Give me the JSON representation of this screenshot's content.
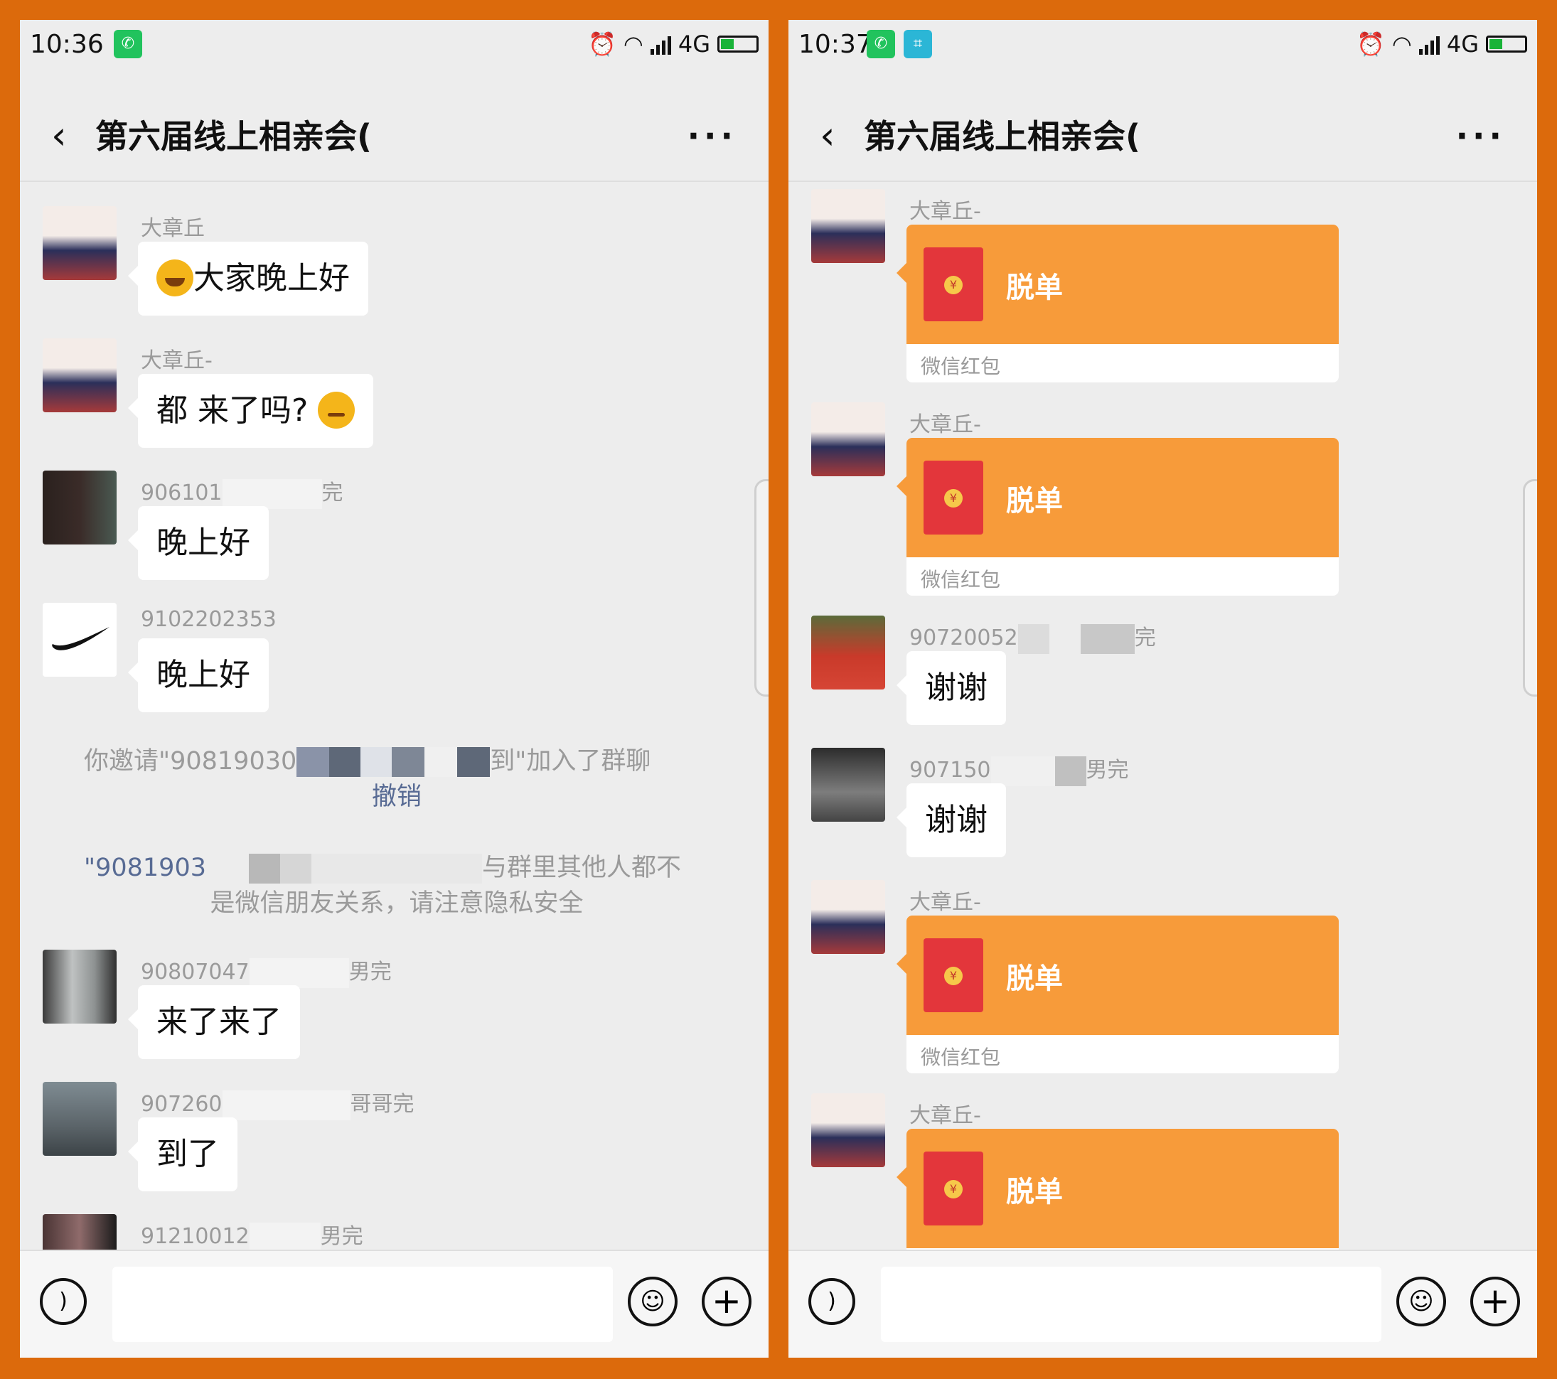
{
  "left": {
    "status": {
      "time": "10:36",
      "network": "4G"
    },
    "title": "第六届线上相亲会(",
    "messages": [
      {
        "sender": "大章丘",
        "text": "大家晚上好"
      },
      {
        "sender": "大章丘-",
        "text": "都 来了吗?"
      },
      {
        "sender": "906101",
        "sender_tail": "完",
        "text": "晚上好"
      },
      {
        "sender": "9102202353",
        "text": "晚上好"
      },
      {
        "sender": "90807047",
        "sender_tail": "男完",
        "text": "来了来了"
      },
      {
        "sender": "907260",
        "sender_tail": "哥哥完",
        "text": "到了"
      },
      {
        "sender": "91210012",
        "sender_tail": "男完",
        "text": ""
      }
    ],
    "system1": {
      "prefix": "你邀请\"90819030",
      "suffix": "到\"加入了群聊",
      "link": "撤销"
    },
    "system2": {
      "prefix": "\"9081903",
      "suffix": "与群里其他人都不",
      "line2": "是微信朋友关系，请注意隐私安全"
    }
  },
  "right": {
    "status": {
      "time": "10:37",
      "network": "4G"
    },
    "title": "第六届线上相亲会(",
    "packet_sender": "大章丘-",
    "packet_title": "脱单",
    "packet_footer": "微信红包",
    "thanks": [
      {
        "sender": "90720052",
        "sender_tail": "完",
        "text": "谢谢"
      },
      {
        "sender": "907150",
        "sender_tail": "男完",
        "text": "谢谢"
      }
    ]
  },
  "colors": {
    "frame": "#dc6a0c",
    "chat_bg": "#ededed",
    "packet": "#f79b3a",
    "envelope": "#e3363b",
    "wechat_green": "#21c35d"
  },
  "icons": {
    "back": "chevron-left-icon",
    "more": "more-dots-icon",
    "voice": "voice-icon",
    "emoji": "emoji-icon",
    "plus": "plus-icon",
    "alarm": "alarm-icon",
    "wifi": "wifi-icon"
  }
}
